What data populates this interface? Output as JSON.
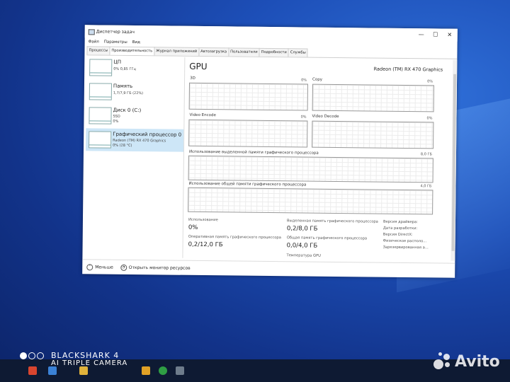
{
  "window": {
    "title": "Диспетчер задач",
    "controls": {
      "minimize": "—",
      "maximize": "☐",
      "close": "✕"
    }
  },
  "menu": [
    "Файл",
    "Параметры",
    "Вид"
  ],
  "tabs": [
    {
      "label": "Процессы"
    },
    {
      "label": "Производительность"
    },
    {
      "label": "Журнал приложений"
    },
    {
      "label": "Автозагрузка"
    },
    {
      "label": "Пользователи"
    },
    {
      "label": "Подробности"
    },
    {
      "label": "Службы"
    }
  ],
  "sidebar": {
    "items": [
      {
        "name": "ЦП",
        "line1": "0% 0,85 ГГц",
        "line2": ""
      },
      {
        "name": "Память",
        "line1": "1,7/7,9 ГБ (22%)",
        "line2": ""
      },
      {
        "name": "Диск 0 (C:)",
        "line1": "SSD",
        "line2": "0%"
      },
      {
        "name": "Графический процессор 0",
        "line1": "Radeon (TM) RX 470 Graphics",
        "line2": "0% (28 °C)"
      }
    ]
  },
  "gpu": {
    "title": "GPU",
    "model": "Radeon (TM) RX 470 Graphics",
    "engines": [
      {
        "label": "3D",
        "pct": "0%"
      },
      {
        "label": "Copy",
        "pct": "0%"
      },
      {
        "label": "Video Encode",
        "pct": "0%"
      },
      {
        "label": "Video Decode",
        "pct": "0%"
      }
    ],
    "dedicated_mem": {
      "label": "Использование выделенной памяти графического процессора",
      "max": "8,0 ГБ"
    },
    "shared_mem": {
      "label": "Использование общей памяти графического процессора",
      "max": "4,0 ГБ"
    }
  },
  "stats": {
    "usage_label": "Использование",
    "usage_value": "0%",
    "gpu_ram_label": "Оперативная память графического процессора",
    "gpu_ram_value": "0,2/12,0 ГБ",
    "dedicated_label": "Выделенная память графического процессора",
    "dedicated_value": "0,2/8,0 ГБ",
    "shared_label": "Общая память графического процессора",
    "shared_value": "0,0/4,0 ГБ",
    "temp_label": "Температура GPU"
  },
  "details": [
    "Версия драйвера:",
    "Дата разработки:",
    "Версия DirectX:",
    "Физическое располо...",
    "Зарезервированная а..."
  ],
  "footer": {
    "less": "Меньше",
    "resource_monitor": "Открыть монитор ресурсов"
  },
  "watermark": {
    "line1": "BLACKSHARK 4",
    "line2": "AI TRIPLE CAMERA",
    "avito": "Avito"
  }
}
